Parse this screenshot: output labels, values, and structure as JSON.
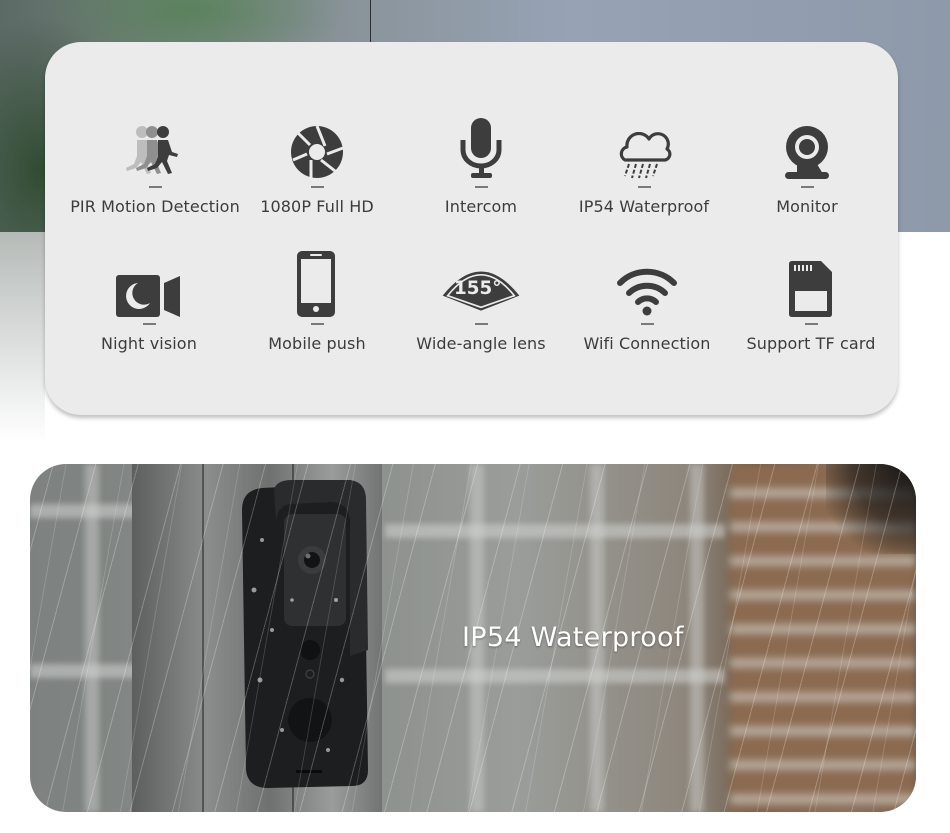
{
  "features": {
    "row1": [
      {
        "icon": "running-person-icon",
        "label": "PIR Motion Detection"
      },
      {
        "icon": "camera-shutter-icon",
        "label": "1080P Full HD"
      },
      {
        "icon": "microphone-icon",
        "label": "Intercom"
      },
      {
        "icon": "rain-cloud-icon",
        "label": "IP54 Waterproof"
      },
      {
        "icon": "webcam-icon",
        "label": "Monitor"
      }
    ],
    "row2": [
      {
        "icon": "night-video-camera-icon",
        "label": "Night vision"
      },
      {
        "icon": "smartphone-icon",
        "label": "Mobile push"
      },
      {
        "icon": "wide-angle-fan-icon",
        "label": "Wide-angle lens",
        "angle_text": "155°"
      },
      {
        "icon": "wifi-icon",
        "label": "Wifi Connection"
      },
      {
        "icon": "sd-card-icon",
        "label": "Support TF card"
      }
    ]
  },
  "photo": {
    "caption": "IP54 Waterproof",
    "subject": "doorbell-camera-in-rain"
  },
  "colors": {
    "icon": "#3d3d3d",
    "label": "#3c3c3c",
    "card_bg": "#ebebeb",
    "caption": "#ffffff"
  }
}
